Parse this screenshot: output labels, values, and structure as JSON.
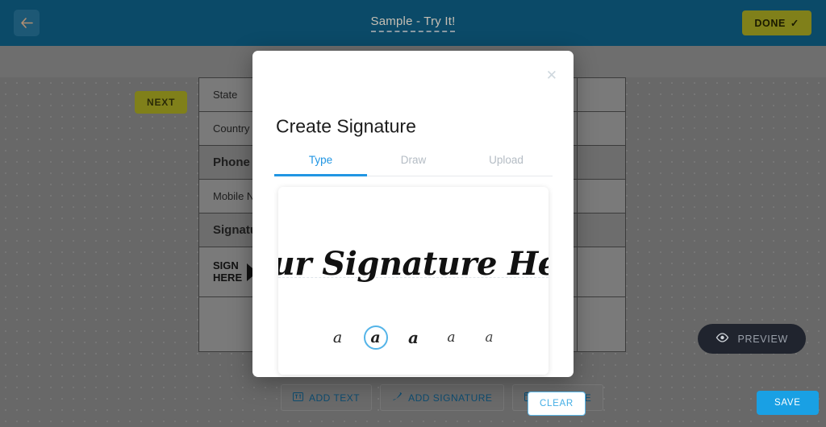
{
  "header": {
    "back_icon": "arrow-left-icon",
    "title": "Sample - Try It!",
    "done_label": "DONE",
    "done_check": "✓"
  },
  "workspace": {
    "next_label": "NEXT",
    "preview_label": "PREVIEW",
    "preview_icon": "eye-icon"
  },
  "document_form": {
    "rows": [
      {
        "label": "State",
        "style": "normal"
      },
      {
        "label": "Country",
        "style": "normal"
      },
      {
        "label": "Phone",
        "style": "header"
      },
      {
        "label": "Mobile Nu",
        "style": "normal"
      },
      {
        "label": "Signatu",
        "style": "header"
      },
      {
        "label": "SIGN HERE",
        "style": "sign"
      },
      {
        "label": "",
        "style": "normal"
      }
    ],
    "sign_here_line1": "SIGN",
    "sign_here_line2": "HERE"
  },
  "toolbar": {
    "buttons": [
      {
        "label": "ADD TEXT",
        "icon": "text-box-icon"
      },
      {
        "label": "ADD SIGNATURE",
        "icon": "pen-icon"
      },
      {
        "label": "ADD DATE",
        "icon": "calendar-icon"
      }
    ]
  },
  "modal": {
    "title": "Create Signature",
    "close_icon": "close-icon",
    "tabs": [
      {
        "label": "Type",
        "active": true
      },
      {
        "label": "Draw",
        "active": false
      },
      {
        "label": "Upload",
        "active": false
      }
    ],
    "signature_value": "Your Signature Here",
    "signature_placeholder": "Your Signature Here",
    "font_options": [
      {
        "glyph": "a",
        "selected": false
      },
      {
        "glyph": "a",
        "selected": true
      },
      {
        "glyph": "a",
        "selected": false
      },
      {
        "glyph": "a",
        "selected": false
      },
      {
        "glyph": "a",
        "selected": false
      }
    ],
    "clear_label": "CLEAR",
    "save_label": "SAVE"
  },
  "colors": {
    "topbar": "#0b4a68",
    "accent_blue": "#19a0e4",
    "done_olive": "#80801a",
    "canvas_gray": "#686868"
  }
}
